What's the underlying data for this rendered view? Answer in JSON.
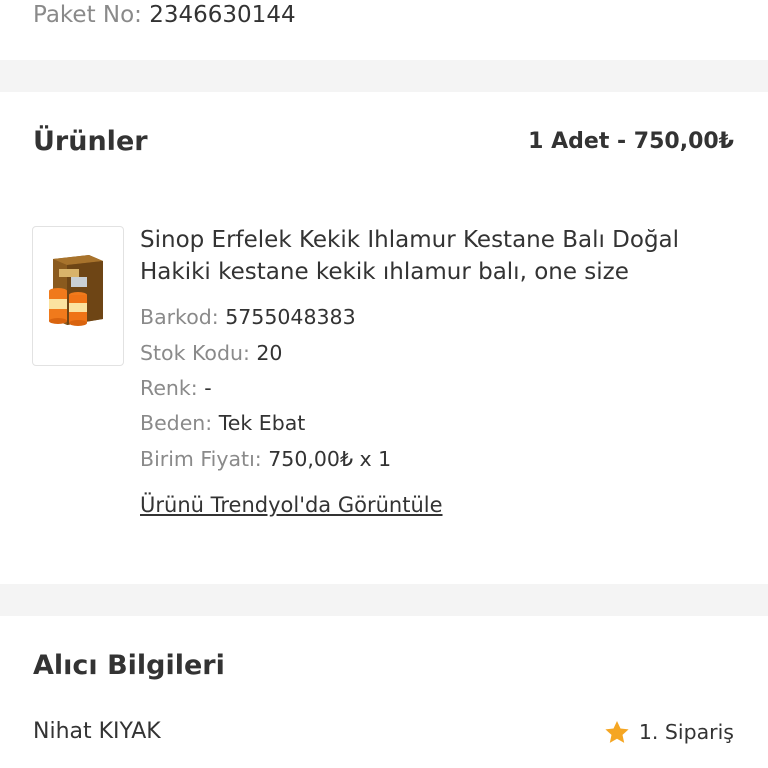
{
  "package": {
    "label": "Paket No:",
    "number": "2346630144"
  },
  "products_section": {
    "title": "Ürünler",
    "summary": "1 Adet - 750,00₺"
  },
  "product": {
    "name": "Sinop Erfelek Kekik Ihlamur Kestane Balı Doğal Hakiki kestane kekik ıhlamur balı, one size",
    "attributes": [
      {
        "label": "Barkod:",
        "value": "5755048383"
      },
      {
        "label": "Stok Kodu:",
        "value": "20"
      },
      {
        "label": "Renk:",
        "value": "-"
      },
      {
        "label": "Beden:",
        "value": "Tek Ebat"
      },
      {
        "label": "Birim Fiyatı:",
        "value": "750,00₺ x 1"
      }
    ],
    "view_link": "Ürünü Trendyol'da Görüntüle",
    "image_icon": "honey-jars-image"
  },
  "buyer_section": {
    "title": "Alıcı Bilgileri",
    "name": "Nihat KIYAK",
    "order_badge": "1. Sipariş",
    "order_icon": "star-icon",
    "star_color": "#f5a623"
  },
  "colors": {
    "section_background": "#f4f4f4",
    "muted_text": "#8a8a8a",
    "primary_text": "#333333"
  }
}
